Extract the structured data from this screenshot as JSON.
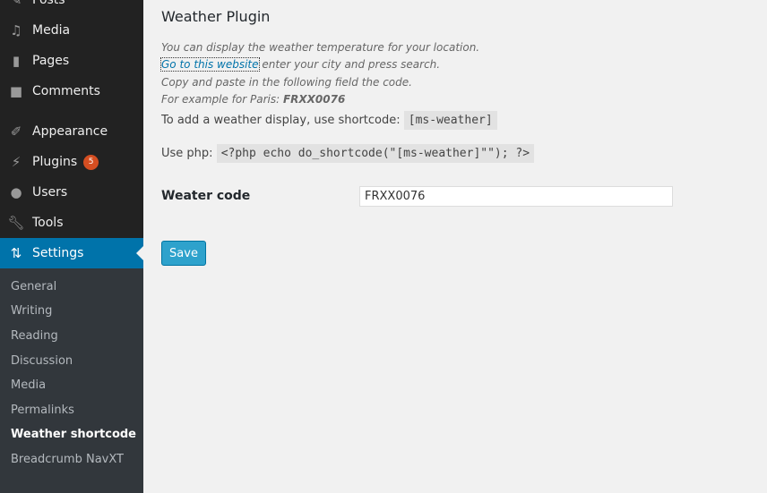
{
  "sidebar": {
    "items": [
      {
        "label": "Posts",
        "icon": "pin-icon"
      },
      {
        "label": "Media",
        "icon": "media-icon"
      },
      {
        "label": "Pages",
        "icon": "pages-icon"
      },
      {
        "label": "Comments",
        "icon": "comments-icon"
      },
      {
        "label": "Appearance",
        "icon": "brush-icon"
      },
      {
        "label": "Plugins",
        "icon": "plugin-icon",
        "badge": "5"
      },
      {
        "label": "Users",
        "icon": "users-icon"
      },
      {
        "label": "Tools",
        "icon": "wrench-icon"
      },
      {
        "label": "Settings",
        "icon": "settings-icon",
        "active": true
      }
    ],
    "submenu": [
      "General",
      "Writing",
      "Reading",
      "Discussion",
      "Media",
      "Permalinks",
      "Weather shortcode",
      "Breadcrumb NavXT"
    ],
    "submenu_current": "Weather shortcode"
  },
  "main": {
    "title": "Weather Plugin",
    "desc1": "You can display the weather temperature for your location.",
    "link": "Go to this website",
    "desc2": " enter your city and press search.",
    "desc3": "Copy and paste in the following field the code.",
    "desc4": "For example for Paris: ",
    "example": "FRXX0076",
    "shortcode_label": "To add a weather display, use shortcode: ",
    "shortcode": "[ms-weather]",
    "php_label": "Use php: ",
    "php": "<?php echo do_shortcode(\"[ms-weather]\"\"); ?>",
    "field_label": "Weater code",
    "field_value": "FRXX0076",
    "save": "Save"
  },
  "colors": {
    "accent": "#0073aa",
    "sidebar": "#222222",
    "button": "#2ea2cc",
    "badge": "#d54e21"
  }
}
